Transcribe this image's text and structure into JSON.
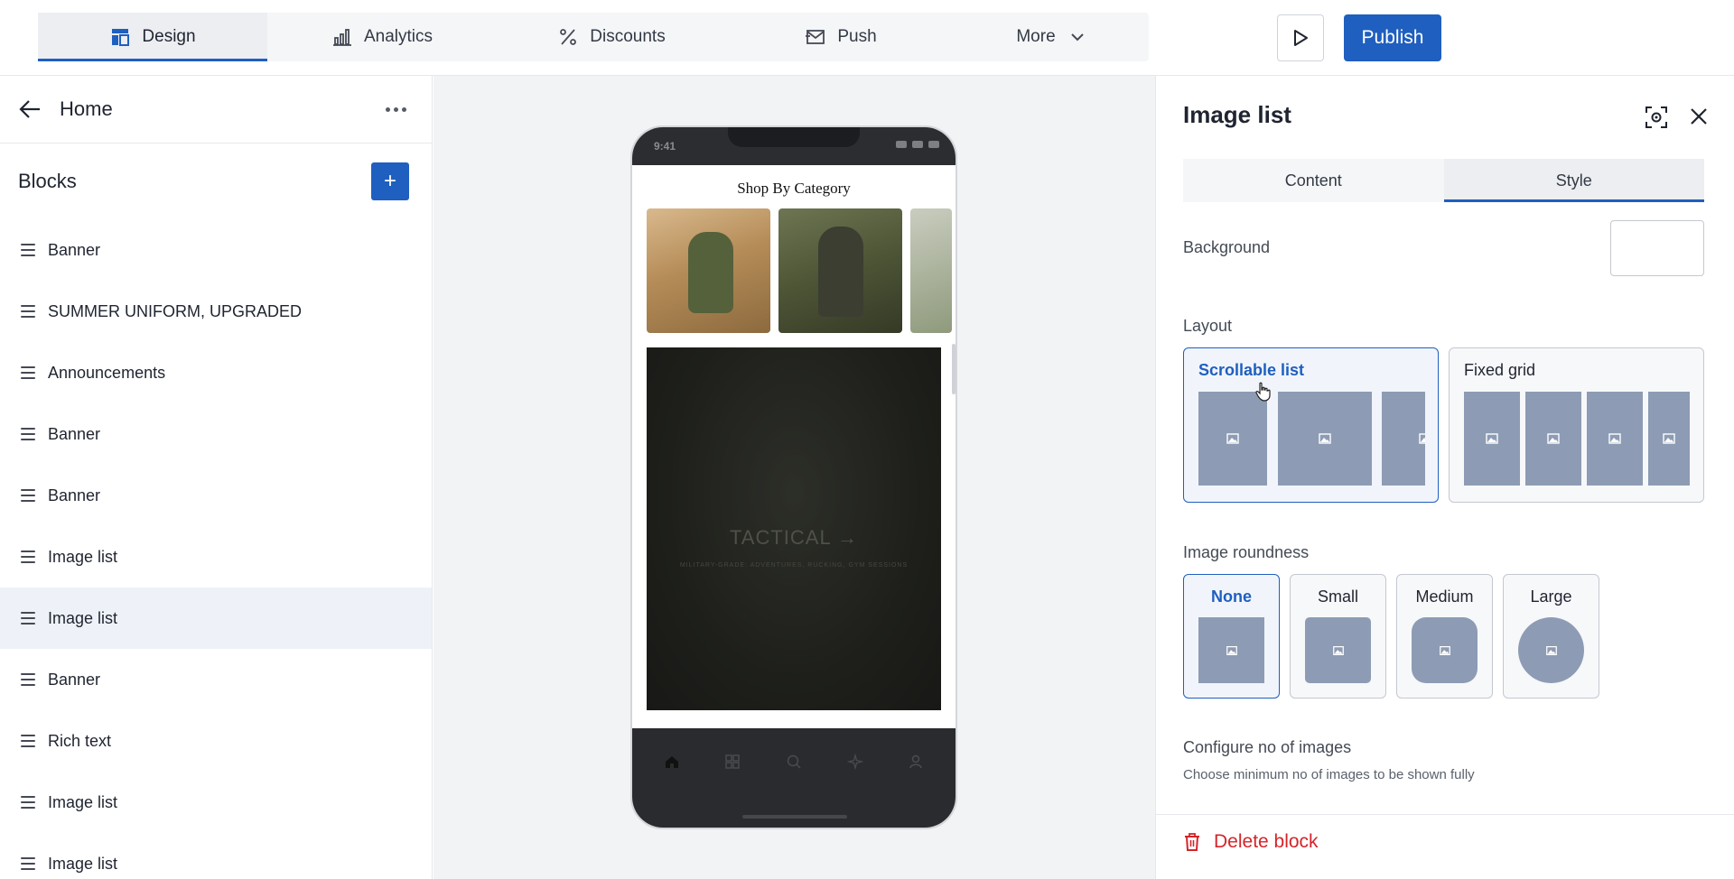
{
  "nav": {
    "tabs": [
      {
        "label": "Design",
        "icon": "layout-icon"
      },
      {
        "label": "Analytics",
        "icon": "chart-icon"
      },
      {
        "label": "Discounts",
        "icon": "percent-icon"
      },
      {
        "label": "Push",
        "icon": "mail-icon"
      },
      {
        "label": "More",
        "icon": "chevron-down-icon"
      }
    ],
    "active": "Design",
    "publish_label": "Publish"
  },
  "sidebar": {
    "page_title": "Home",
    "blocks_title": "Blocks",
    "add_label": "+",
    "items": [
      {
        "label": "Banner"
      },
      {
        "label": "SUMMER UNIFORM, UPGRADED"
      },
      {
        "label": "Announcements"
      },
      {
        "label": "Banner"
      },
      {
        "label": "Banner"
      },
      {
        "label": "Image list"
      },
      {
        "label": "Image list"
      },
      {
        "label": "Banner"
      },
      {
        "label": "Rich text"
      },
      {
        "label": "Image list"
      },
      {
        "label": "Image list"
      }
    ],
    "selected_index": 6
  },
  "preview": {
    "time": "9:41",
    "section_title": "Shop By Category",
    "banner_title": "TACTICAL →",
    "banner_subtitle": "MILITARY-GRADE: ADVENTURES, RUCKING, GYM SESSIONS"
  },
  "panel": {
    "title": "Image list",
    "tabs": [
      {
        "label": "Content"
      },
      {
        "label": "Style"
      }
    ],
    "active_tab": "Style",
    "background_label": "Background",
    "background_color": "#ffffff",
    "layout_label": "Layout",
    "layout_options": [
      {
        "label": "Scrollable list"
      },
      {
        "label": "Fixed grid"
      }
    ],
    "layout_selected": "Scrollable list",
    "roundness_label": "Image roundness",
    "roundness_options": [
      {
        "label": "None"
      },
      {
        "label": "Small"
      },
      {
        "label": "Medium"
      },
      {
        "label": "Large"
      }
    ],
    "roundness_selected": "None",
    "config_title": "Configure no of images",
    "config_subtitle": "Choose minimum no of images to be shown fully",
    "delete_label": "Delete block"
  },
  "colors": {
    "accent": "#1f5fbf",
    "danger": "#d4242a",
    "thumb": "#8d9cb4"
  }
}
